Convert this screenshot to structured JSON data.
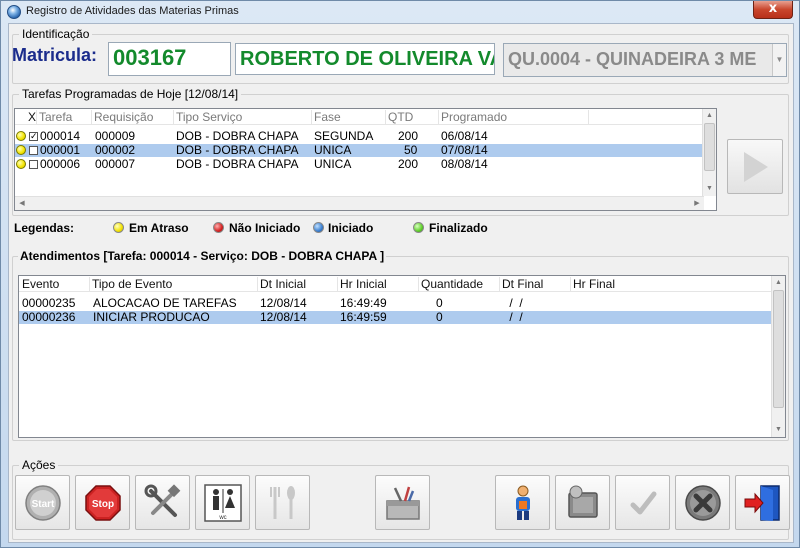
{
  "window": {
    "title": "Registro de Atividades das Materias Primas",
    "close_glyph": "x"
  },
  "identificacao": {
    "legend": "Identificação",
    "matricula_label": "Matricula:",
    "matricula_value": "003167",
    "nome": "ROBERTO DE OLIVEIRA VA",
    "maquina": "QU.0004 - QUINADEIRA 3 ME"
  },
  "tarefas": {
    "legend": "Tarefas Programadas de Hoje [12/08/14]",
    "columns": [
      "X",
      "Tarefa",
      "Requisição",
      "Tipo Serviço",
      "Fase",
      "QTD",
      "Programado"
    ],
    "rows": [
      {
        "checked": true,
        "tarefa": "000014",
        "requisicao": "000009",
        "tipo": "DOB - DOBRA CHAPA",
        "fase": "SEGUNDA",
        "qtd": "200",
        "programado": "06/08/14",
        "selected": false
      },
      {
        "checked": false,
        "tarefa": "000001",
        "requisicao": "000002",
        "tipo": "DOB - DOBRA CHAPA",
        "fase": "UNICA",
        "qtd": "50",
        "programado": "07/08/14",
        "selected": true
      },
      {
        "checked": false,
        "tarefa": "000006",
        "requisicao": "000007",
        "tipo": "DOB - DOBRA CHAPA",
        "fase": "UNICA",
        "qtd": "200",
        "programado": "08/08/14",
        "selected": false
      }
    ]
  },
  "legendas": {
    "title": "Legendas:",
    "items": [
      {
        "label": "Em Atraso",
        "color": "#f2e200"
      },
      {
        "label": "Não Iniciado",
        "color": "#d42020"
      },
      {
        "label": "Iniciado",
        "color": "#3a7fd0"
      },
      {
        "label": "Finalizado",
        "color": "#5fcf2a"
      }
    ]
  },
  "atendimentos": {
    "title": "Atendimentos [Tarefa: 000014 - Serviço: DOB - DOBRA CHAPA ]",
    "columns": [
      "Evento",
      "Tipo de Evento",
      "Dt Inicial",
      "Hr Inicial",
      "Quantidade",
      "Dt Final",
      "Hr Final"
    ],
    "rows": [
      {
        "evento": "00000235",
        "tipo": "ALOCACAO DE TAREFAS",
        "dt_inicial": "12/08/14",
        "hr_inicial": "16:49:49",
        "quantidade": "0",
        "dt_final": " /  /",
        "hr_final": "",
        "selected": false
      },
      {
        "evento": "00000236",
        "tipo": "INICIAR PRODUCAO",
        "dt_inicial": "12/08/14",
        "hr_inicial": "16:49:59",
        "quantidade": "0",
        "dt_final": " /  /",
        "hr_final": "",
        "selected": true
      }
    ]
  },
  "acoes": {
    "legend": "Ações",
    "buttons": [
      {
        "icon": "start-icon",
        "label": "Start"
      },
      {
        "icon": "stop-icon",
        "label": "Stop"
      },
      {
        "icon": "tools-icon"
      },
      {
        "icon": "restroom-icon",
        "label": "wc"
      },
      {
        "icon": "meal-icon"
      },
      {
        "icon": "toolbox-icon"
      },
      {
        "icon": "person-icon"
      },
      {
        "icon": "screen-icon"
      },
      {
        "icon": "checkmark-icon"
      },
      {
        "icon": "cancel-icon"
      },
      {
        "icon": "exit-icon"
      }
    ]
  }
}
